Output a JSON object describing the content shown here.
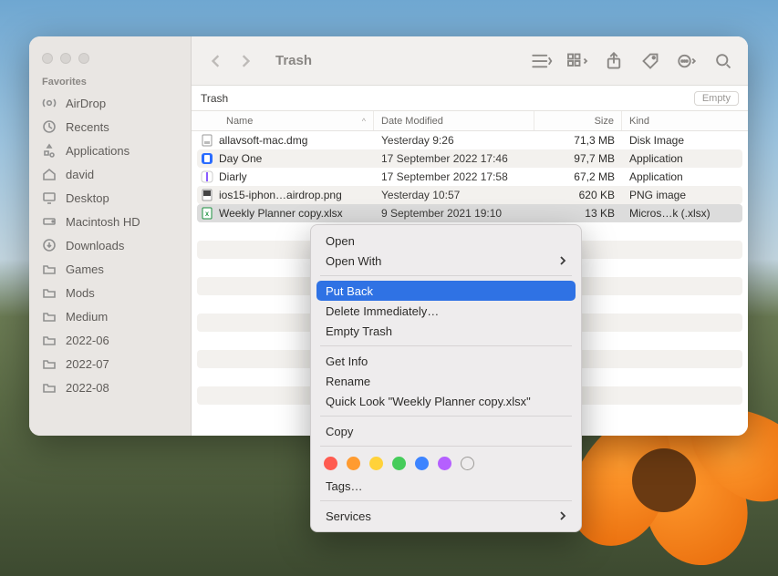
{
  "window": {
    "title": "Trash",
    "pathbar_title": "Trash",
    "empty_button": "Empty"
  },
  "sidebar": {
    "section_label": "Favorites",
    "items": [
      {
        "icon": "airdrop-icon",
        "label": "AirDrop"
      },
      {
        "icon": "clock-icon",
        "label": "Recents"
      },
      {
        "icon": "apps-icon",
        "label": "Applications"
      },
      {
        "icon": "home-icon",
        "label": "david"
      },
      {
        "icon": "desktop-icon",
        "label": "Desktop"
      },
      {
        "icon": "hdd-icon",
        "label": "Macintosh HD"
      },
      {
        "icon": "download-icon",
        "label": "Downloads"
      },
      {
        "icon": "folder-icon",
        "label": "Games"
      },
      {
        "icon": "folder-icon",
        "label": "Mods"
      },
      {
        "icon": "folder-icon",
        "label": "Medium"
      },
      {
        "icon": "folder-icon",
        "label": "2022-06"
      },
      {
        "icon": "folder-icon",
        "label": "2022-07"
      },
      {
        "icon": "folder-icon",
        "label": "2022-08"
      }
    ]
  },
  "columns": {
    "name": "Name",
    "date": "Date Modified",
    "size": "Size",
    "kind": "Kind",
    "sort_indicator": "^"
  },
  "files": [
    {
      "icon": "dmg",
      "name": "allavsoft-mac.dmg",
      "date": "Yesterday 9:26",
      "size": "71,3 MB",
      "kind": "Disk Image"
    },
    {
      "icon": "app",
      "name": "Day One",
      "date": "17 September 2022 17:46",
      "size": "97,7 MB",
      "kind": "Application"
    },
    {
      "icon": "app2",
      "name": "Diarly",
      "date": "17 September 2022 17:58",
      "size": "67,2 MB",
      "kind": "Application"
    },
    {
      "icon": "png",
      "name": "ios15-iphon…airdrop.png",
      "date": "Yesterday 10:57",
      "size": "620 KB",
      "kind": "PNG image"
    },
    {
      "icon": "xlsx",
      "name": "Weekly Planner copy.xlsx",
      "date": "9 September 2021 19:10",
      "size": "13 KB",
      "kind": "Micros…k (.xlsx)"
    }
  ],
  "context_menu": {
    "open": "Open",
    "open_with": "Open With",
    "put_back": "Put Back",
    "delete_immediately": "Delete Immediately…",
    "empty_trash": "Empty Trash",
    "get_info": "Get Info",
    "rename": "Rename",
    "quick_look": "Quick Look \"Weekly Planner copy.xlsx\"",
    "copy": "Copy",
    "tags": "Tags…",
    "services": "Services",
    "highlighted": "put_back"
  },
  "colors": {
    "highlight": "#2f72e4",
    "sidebar_bg": "#e9e6e3",
    "toolbar_bg": "#f2f0ee"
  }
}
